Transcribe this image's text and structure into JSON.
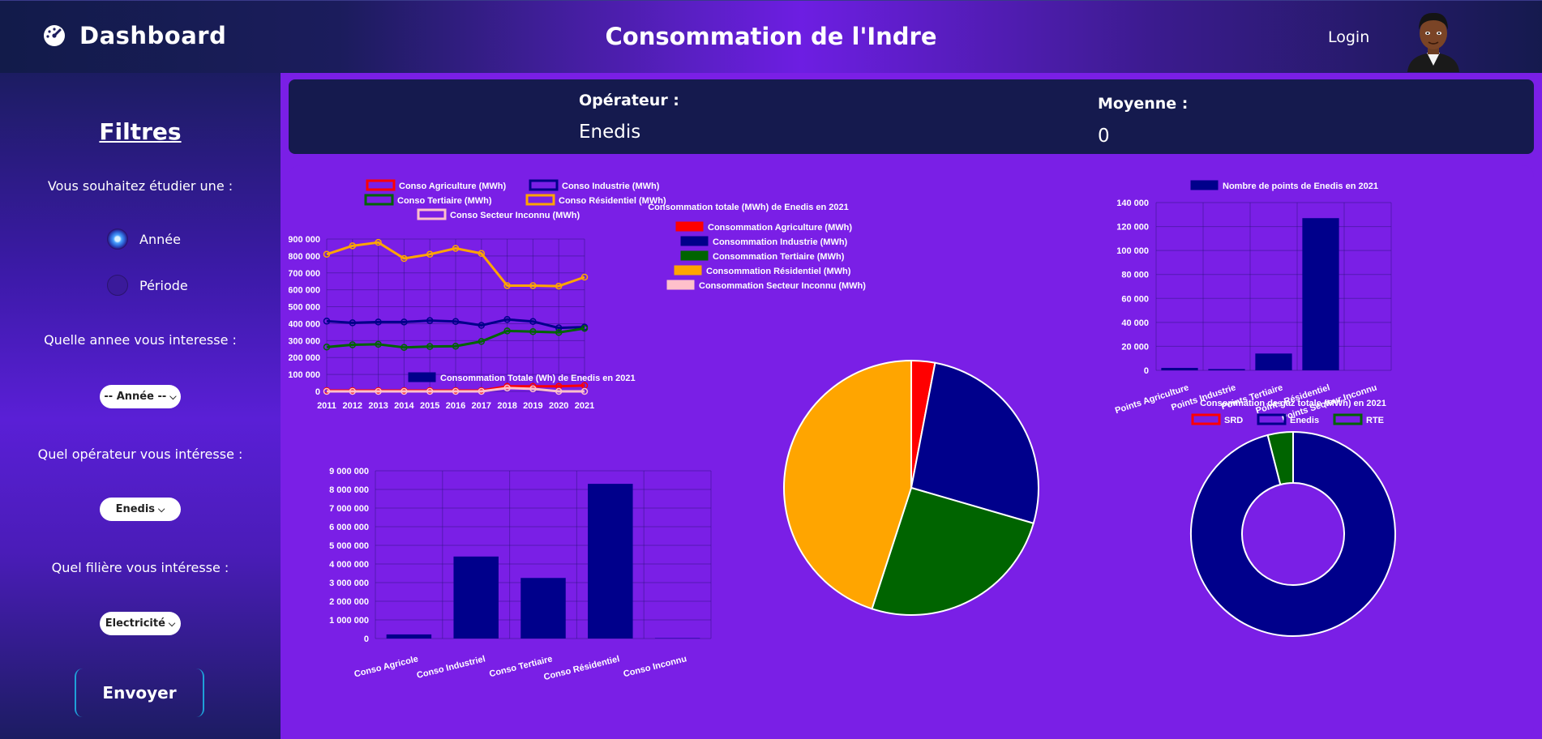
{
  "header": {
    "brand": "Dashboard",
    "brand_icon": "gauge-icon",
    "title": "Consommation de l'Indre",
    "login": "Login",
    "avatar_icon": "avatar-icon"
  },
  "sidebar": {
    "title": "Filtres",
    "study_question": "Vous souhaitez étudier une :",
    "radio_year": "Année",
    "radio_period": "Période",
    "radio_selected": "Année",
    "year_question": "Quelle annee vous interesse :",
    "year_select": "-- Année --",
    "operator_question": "Quel opérateur vous intéresse :",
    "operator_select": "Enedis",
    "sector_question": "Quel filière vous intéresse :",
    "sector_select": "Electricité",
    "submit": "Envoyer"
  },
  "info": {
    "operator_label": "Opérateur :",
    "operator_value": "Enedis",
    "average_label": "Moyenne :",
    "average_value": "0"
  },
  "colors": {
    "agriculture": "#ff0000",
    "industrie": "#00008b",
    "tertiaire": "#006400",
    "residentiel": "#ffa500",
    "inconnu": "#ffc0cb",
    "navy": "#00008b"
  },
  "chart_data": [
    {
      "type": "line",
      "x": [
        "2011",
        "2012",
        "2013",
        "2014",
        "2015",
        "2016",
        "2017",
        "2018",
        "2019",
        "2020",
        "2021"
      ],
      "ylim": [
        0,
        900000
      ],
      "yticks": [
        "900 000",
        "800 000",
        "700 000",
        "600 000",
        "500 000",
        "400 000",
        "300 000",
        "200 000",
        "100 000",
        "0"
      ],
      "series": [
        {
          "name": "Conso Agriculture (MWh)",
          "color": "#ff0000",
          "values": [
            5000,
            5000,
            5000,
            5000,
            5000,
            5000,
            5000,
            30000,
            30000,
            30000,
            35000
          ]
        },
        {
          "name": "Conso Industrie (MWh)",
          "color": "#00008b",
          "values": [
            415000,
            405000,
            410000,
            410000,
            418000,
            413000,
            390000,
            425000,
            413000,
            375000,
            380000
          ]
        },
        {
          "name": "Conso Tertiaire  (MWh)",
          "color": "#006400",
          "values": [
            262000,
            275000,
            278000,
            260000,
            265000,
            267000,
            295000,
            357000,
            353000,
            348000,
            372000
          ]
        },
        {
          "name": "Conso Résidentiel  (MWh)",
          "color": "#ffa500",
          "values": [
            810000,
            860000,
            880000,
            785000,
            810000,
            845000,
            815000,
            625000,
            625000,
            622000,
            675000
          ]
        },
        {
          "name": "Conso Secteur Inconnu (MWh)",
          "color": "#ffc0cb",
          "values": [
            0,
            0,
            0,
            0,
            0,
            0,
            0,
            20000,
            15000,
            0,
            0
          ]
        }
      ]
    },
    {
      "type": "bar",
      "series": [
        {
          "name": "Consommation Totale (Wh) de Enedis en 2021"
        }
      ],
      "categories": [
        "Conso Agricole",
        "Conso Industriel",
        "Conso Tertiaire",
        "Conso Résidentiel",
        "Conso Inconnu"
      ],
      "values": [
        220000,
        4400000,
        3250000,
        8300000,
        20000
      ],
      "ylim": [
        0,
        9000000
      ],
      "yticks": [
        "9 000 000",
        "8 000 000",
        "7 000 000",
        "6 000 000",
        "5 000 000",
        "4 000 000",
        "3 000 000",
        "2 000 000",
        "1 000 000",
        "0"
      ],
      "color": "#00008b"
    },
    {
      "type": "pie",
      "title": "Consommation totale (MWh) de Enedis en 2021",
      "labels": [
        "Consommation Agriculture (MWh)",
        "Consommation Industrie (MWh)",
        "Consommation Tertiaire  (MWh)",
        "Consommation Résidentiel  (MWh)",
        "Consommation Secteur Inconnu (MWh)"
      ],
      "values": [
        3,
        26.5,
        25.5,
        45,
        0
      ],
      "colors": [
        "#ff0000",
        "#00008b",
        "#006400",
        "#ffa500",
        "#ffc0cb"
      ]
    },
    {
      "type": "bar",
      "series": [
        {
          "name": "Nombre de points de Enedis  en 2021"
        }
      ],
      "categories": [
        "Points Agriculture",
        "Points Industrie",
        "Points Tertiaire",
        "Points Résidentiel",
        "Points Secteur Inconnu"
      ],
      "values": [
        2000,
        500,
        14000,
        127000,
        0
      ],
      "ylim": [
        0,
        140000
      ],
      "yticks": [
        "140 000",
        "120 000",
        "100 000",
        "80 000",
        "60 000",
        "40 000",
        "20 000",
        "0"
      ],
      "color": "#00008b"
    },
    {
      "type": "pie",
      "title": "Consommation de gaz totale (MWh)  en 2021",
      "labels": [
        "SRD",
        "Enedis",
        "RTE"
      ],
      "values": [
        0,
        96,
        4
      ],
      "colors": [
        "#ff0000",
        "#00008b",
        "#006400"
      ]
    }
  ]
}
